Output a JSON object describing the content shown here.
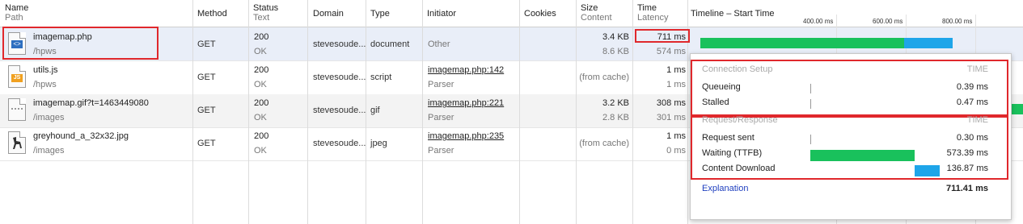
{
  "columns": {
    "name": {
      "label": "Name",
      "sub": "Path"
    },
    "method": {
      "label": "Method"
    },
    "status": {
      "label": "Status",
      "sub": "Text"
    },
    "domain": {
      "label": "Domain"
    },
    "type": {
      "label": "Type"
    },
    "initiator": {
      "label": "Initiator"
    },
    "cookies": {
      "label": "Cookies"
    },
    "size": {
      "label": "Size",
      "sub": "Content"
    },
    "time": {
      "label": "Time",
      "sub": "Latency"
    },
    "timeline": {
      "label": "Timeline – Start Time"
    }
  },
  "timeline_ticks": [
    "400.00 ms",
    "600.00 ms",
    "800.00 ms"
  ],
  "rows": [
    {
      "name": "imagemap.php",
      "path": "/hpws",
      "method": "GET",
      "status": "200",
      "status_text": "OK",
      "domain": "stevesoude...",
      "type": "document",
      "initiator": "Other",
      "initiator_sub": "",
      "size": "3.4 KB",
      "content": "8.6 KB",
      "time": "711 ms",
      "latency": "574 ms",
      "icon": "html-file-icon"
    },
    {
      "name": "utils.js",
      "path": "/hpws",
      "method": "GET",
      "status": "200",
      "status_text": "OK",
      "domain": "stevesoude...",
      "type": "script",
      "initiator": "imagemap.php:142",
      "initiator_sub": "Parser",
      "size": "(from cache)",
      "content": "",
      "time": "1 ms",
      "latency": "1 ms",
      "icon": "js-file-icon"
    },
    {
      "name": "imagemap.gif?t=1463449080",
      "path": "/images",
      "method": "GET",
      "status": "200",
      "status_text": "OK",
      "domain": "stevesoude...",
      "type": "gif",
      "initiator": "imagemap.php:221",
      "initiator_sub": "Parser",
      "size": "3.2 KB",
      "content": "2.8 KB",
      "time": "308 ms",
      "latency": "301 ms",
      "icon": "image-file-icon"
    },
    {
      "name": "greyhound_a_32x32.jpg",
      "path": "/images",
      "method": "GET",
      "status": "200",
      "status_text": "OK",
      "domain": "stevesoude...",
      "type": "jpeg",
      "initiator": "imagemap.php:235",
      "initiator_sub": "Parser",
      "size": "(from cache)",
      "content": "",
      "time": "1 ms",
      "latency": "0 ms",
      "icon": "greyhound-image-icon"
    }
  ],
  "popup": {
    "connection_setup": "Connection Setup",
    "time_head": "TIME",
    "queueing_label": "Queueing",
    "queueing_value": "0.39 ms",
    "stalled_label": "Stalled",
    "stalled_value": "0.47 ms",
    "request_response": "Request/Response",
    "time_head2": "TIME",
    "request_sent_label": "Request sent",
    "request_sent_value": "0.30 ms",
    "waiting_label": "Waiting (TTFB)",
    "waiting_value": "573.39 ms",
    "download_label": "Content Download",
    "download_value": "136.87 ms",
    "explanation": "Explanation",
    "total": "711.41 ms"
  },
  "colors": {
    "waiting": "#19c15c",
    "download": "#1ea5e9",
    "highlight": "#e0282c",
    "link": "#1f3fbf"
  }
}
